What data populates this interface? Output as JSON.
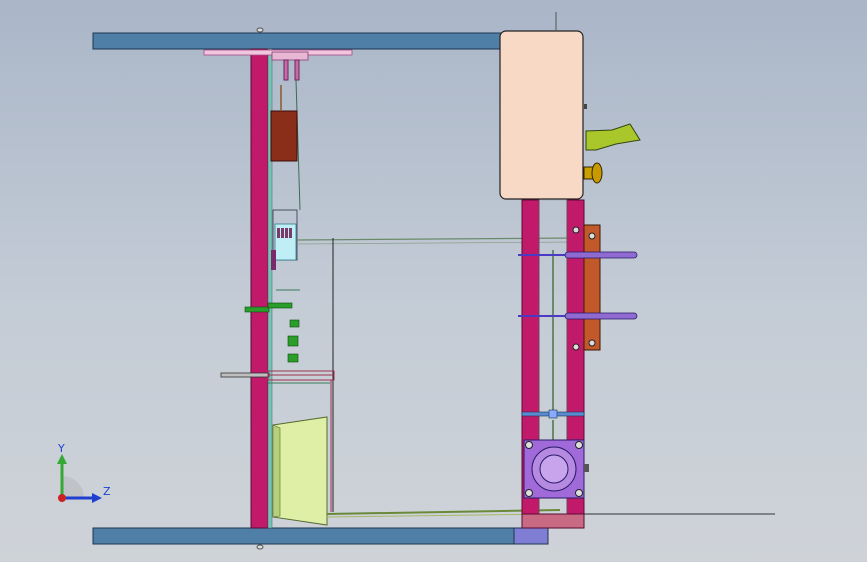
{
  "viewport": {
    "background_top": "#aab6c8",
    "background_bottom": "#cfd3d8"
  },
  "triad": {
    "y_label": "Y",
    "z_label": "Z",
    "y_color": "#33aa33",
    "z_color": "#1f3fcf",
    "origin_color": "#cc2222"
  },
  "colors": {
    "plate": "#4f7fa6",
    "plate_edge": "#1c3650",
    "magenta": "#c21a6a",
    "box": "#f8d9c6",
    "brown": "#8a2e1a",
    "orange": "#c2592a",
    "lime": "#dff0a6",
    "purple": "#a06ad8",
    "green": "#2a9d2a",
    "blue_rod": "#4a3bc4",
    "olive": "#a9c62a",
    "yellow": "#c9a000"
  }
}
